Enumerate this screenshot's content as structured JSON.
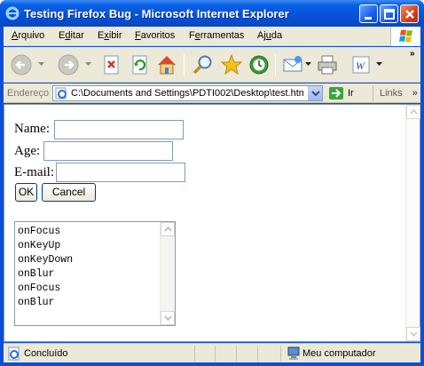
{
  "window": {
    "title": "Testing Firefox Bug - Microsoft Internet Explorer"
  },
  "menu": {
    "items": [
      {
        "pre": "",
        "key": "A",
        "post": "rquivo"
      },
      {
        "pre": "E",
        "key": "d",
        "post": "itar"
      },
      {
        "pre": "E",
        "key": "x",
        "post": "ibir"
      },
      {
        "pre": "",
        "key": "F",
        "post": "avoritos"
      },
      {
        "pre": "F",
        "key": "e",
        "post": "rramentas"
      },
      {
        "pre": "Aj",
        "key": "u",
        "post": "da"
      }
    ]
  },
  "toolbar": {
    "icons": [
      "back-icon",
      "forward-icon",
      "stop-icon",
      "refresh-icon",
      "home-icon",
      "search-icon",
      "favorites-icon",
      "history-icon",
      "mail-icon",
      "print-icon",
      "edit-icon"
    ],
    "overflow": "»"
  },
  "address": {
    "label": "Endereço",
    "value": "C:\\Documents and Settings\\PDTI002\\Desktop\\test.htm",
    "go_label": "Ir",
    "links_label": "Links",
    "links_overflow": "»"
  },
  "form": {
    "name_label": "Name:",
    "age_label": "Age:",
    "email_label": "E-mail:",
    "name_value": "",
    "age_value": "",
    "email_value": "",
    "ok_label": "OK",
    "cancel_label": "Cancel"
  },
  "log": {
    "lines": [
      "onFocus",
      "onKeyUp",
      "onKeyDown",
      "onBlur",
      "onFocus",
      "onBlur"
    ]
  },
  "status": {
    "text": "Concluído",
    "zone": "Meu computador"
  },
  "colors": {
    "titlebar": "#0553d9",
    "chrome": "#ece9d8",
    "input_border": "#7f9db9",
    "close_button": "#d6401c"
  }
}
